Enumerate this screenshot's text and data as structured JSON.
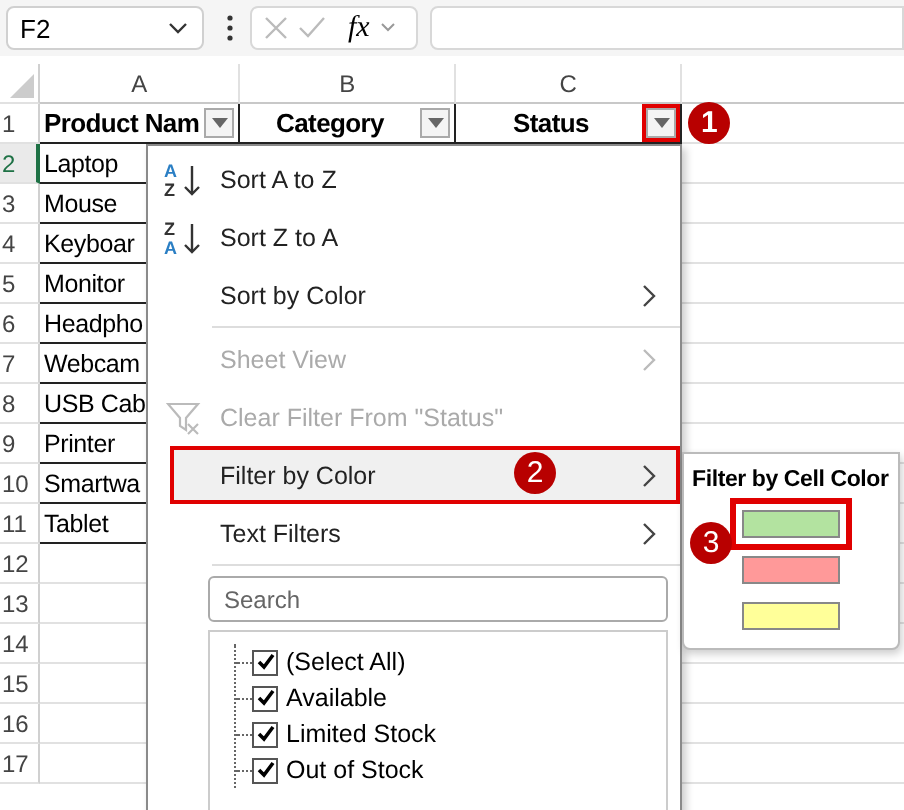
{
  "formula_bar": {
    "name_box": "F2",
    "function_label": "fx"
  },
  "columns": [
    {
      "label": "A"
    },
    {
      "label": "B"
    },
    {
      "label": "C"
    }
  ],
  "header_row": {
    "number": "1",
    "cells": [
      {
        "text": "Product Nam",
        "filter_highlighted": false
      },
      {
        "text": "Category",
        "filter_highlighted": false
      },
      {
        "text": "Status",
        "filter_highlighted": true,
        "callout": "1"
      }
    ]
  },
  "rows": [
    {
      "number": "2",
      "value": "Laptop",
      "selected": true
    },
    {
      "number": "3",
      "value": "Mouse",
      "selected": false
    },
    {
      "number": "4",
      "value": "Keyboar",
      "selected": false
    },
    {
      "number": "5",
      "value": "Monitor",
      "selected": false
    },
    {
      "number": "6",
      "value": "Headpho",
      "selected": false
    },
    {
      "number": "7",
      "value": "Webcam",
      "selected": false
    },
    {
      "number": "8",
      "value": "USB Cab",
      "selected": false
    },
    {
      "number": "9",
      "value": "Printer",
      "selected": false
    },
    {
      "number": "10",
      "value": "Smartwa",
      "selected": false
    },
    {
      "number": "11",
      "value": "Tablet",
      "selected": false
    },
    {
      "number": "12",
      "selected": false
    },
    {
      "number": "13",
      "selected": false
    },
    {
      "number": "14",
      "selected": false
    },
    {
      "number": "15",
      "selected": false
    },
    {
      "number": "16",
      "selected": false
    },
    {
      "number": "17",
      "selected": false
    }
  ],
  "menu": {
    "items": [
      {
        "kind": "sort",
        "letters": [
          {
            "text": "A",
            "accent": true
          },
          {
            "text": "Z",
            "accent": false
          }
        ],
        "label": "Sort A to Z",
        "submenu": false,
        "disabled": false,
        "selected": false
      },
      {
        "kind": "sort",
        "letters": [
          {
            "text": "Z",
            "accent": false
          },
          {
            "text": "A",
            "accent": true
          }
        ],
        "label": "Sort Z to A",
        "submenu": false,
        "disabled": false,
        "selected": false
      },
      {
        "kind": "command",
        "label": "Sort by Color",
        "submenu": true,
        "disabled": false,
        "selected": false
      },
      {
        "kind": "separator"
      },
      {
        "kind": "command",
        "label": "Sheet View",
        "submenu": true,
        "disabled": true,
        "selected": false
      },
      {
        "kind": "clear",
        "label": "Clear Filter From \"Status\"",
        "submenu": false,
        "disabled": true,
        "selected": false
      },
      {
        "kind": "command",
        "label": "Filter by Color",
        "submenu": true,
        "disabled": false,
        "selected": true,
        "highlighted": true,
        "callout": "2"
      },
      {
        "kind": "command",
        "label": "Text Filters",
        "submenu": true,
        "disabled": false,
        "selected": false
      },
      {
        "kind": "separator"
      }
    ],
    "search": {
      "placeholder": "Search"
    },
    "values": [
      {
        "label": "(Select All)",
        "checked": true
      },
      {
        "label": "Available",
        "checked": true
      },
      {
        "label": "Limited Stock",
        "checked": true
      },
      {
        "label": "Out of Stock",
        "checked": true
      }
    ]
  },
  "submenu": {
    "title": "Filter by Cell Color",
    "swatches": [
      {
        "color": "#b3e3a0",
        "highlighted": true,
        "callout": "3"
      },
      {
        "color": "#ff9999",
        "highlighted": false
      },
      {
        "color": "#ffff99",
        "highlighted": false
      }
    ]
  }
}
